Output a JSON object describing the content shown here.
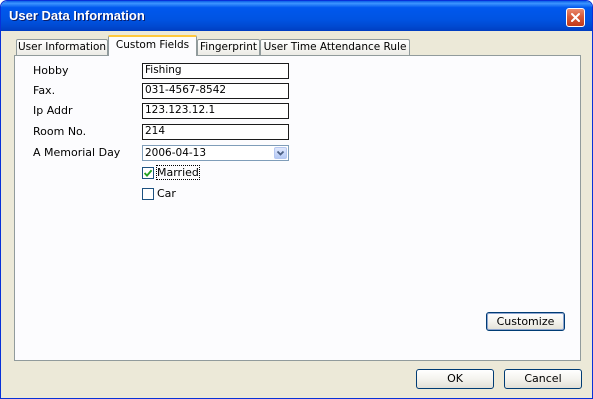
{
  "window": {
    "title": "User Data Information",
    "close_icon": "close-icon"
  },
  "tabs": [
    {
      "label": "User Information",
      "active": false
    },
    {
      "label": "Custom Fields",
      "active": true
    },
    {
      "label": "Fingerprint",
      "active": false
    },
    {
      "label": "User Time Attendance Rule",
      "active": false
    }
  ],
  "fields": {
    "hobby": {
      "label": "Hobby",
      "value": "Fishing"
    },
    "fax": {
      "label": "Fax.",
      "value": "031-4567-8542"
    },
    "ip": {
      "label": "Ip Addr",
      "value": "123.123.12.1"
    },
    "room": {
      "label": "Room No.",
      "value": "214"
    },
    "memorial": {
      "label": "A Memorial Day",
      "value": "2006-04-13",
      "icon": "chevron-down-icon"
    }
  },
  "checkboxes": {
    "married": {
      "label": "Married",
      "checked": true
    },
    "car": {
      "label": "Car",
      "checked": false
    }
  },
  "buttons": {
    "customize": "Customize",
    "ok": "OK",
    "cancel": "Cancel"
  },
  "colors": {
    "titlebar": "#0054e3",
    "window_bg": "#ece9d8",
    "active_tab_accent": "#ffc83c",
    "close_button": "#d75a38",
    "check_mark": "#21a121"
  }
}
